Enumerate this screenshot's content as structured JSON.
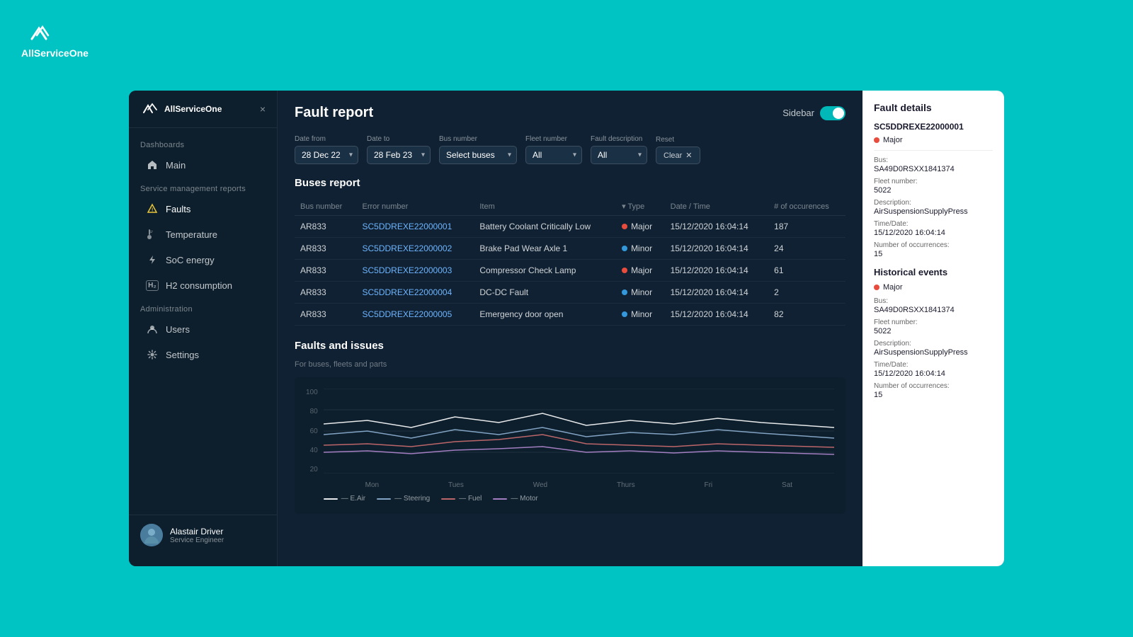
{
  "app": {
    "name": "AllServiceOne",
    "bg_color": "#00c4c4"
  },
  "sidebar": {
    "logo_text": "AllServiceOne",
    "close_icon": "×",
    "sections": [
      {
        "label": "Dashboards",
        "items": [
          {
            "id": "main",
            "label": "Main",
            "icon": "🏠",
            "active": false
          }
        ]
      },
      {
        "label": "Service management reports",
        "items": [
          {
            "id": "faults",
            "label": "Faults",
            "icon": "⚠",
            "active": true
          },
          {
            "id": "temperature",
            "label": "Temperature",
            "icon": "📊",
            "active": false
          },
          {
            "id": "soc-energy",
            "label": "SoC energy",
            "icon": "⚡",
            "active": false
          },
          {
            "id": "h2-consumption",
            "label": "H2 consumption",
            "icon": "H₂",
            "active": false
          }
        ]
      },
      {
        "label": "Administration",
        "items": [
          {
            "id": "users",
            "label": "Users",
            "icon": "👤",
            "active": false
          },
          {
            "id": "settings",
            "label": "Settings",
            "icon": "⚙",
            "active": false
          }
        ]
      }
    ],
    "user": {
      "name": "Alastair Driver",
      "role": "Service Engineer"
    }
  },
  "page": {
    "title": "Fault report",
    "sidebar_toggle_label": "Sidebar"
  },
  "filters": {
    "date_from_label": "Date from",
    "date_from_value": "28 Dec 22",
    "date_to_label": "Date to",
    "date_to_value": "28 Feb 23",
    "bus_number_label": "Bus number",
    "bus_number_value": "Select buses",
    "fleet_number_label": "Fleet number",
    "fleet_number_value": "All",
    "fault_description_label": "Fault description",
    "fault_description_value": "All",
    "reset_label": "Reset",
    "clear_label": "Clear"
  },
  "buses_report": {
    "title": "Buses report",
    "columns": [
      "Bus number",
      "Error number",
      "Item",
      "Type",
      "Date / Time",
      "# of occurences"
    ],
    "rows": [
      {
        "bus": "AR833",
        "error": "SC5DDREXE22000001",
        "item": "Battery Coolant Critically Low",
        "type": "Major",
        "datetime": "15/12/2020 16:04:14",
        "occurrences": "187"
      },
      {
        "bus": "AR833",
        "error": "SC5DDREXE22000002",
        "item": "Brake Pad Wear Axle 1",
        "type": "Minor",
        "datetime": "15/12/2020 16:04:14",
        "occurrences": "24"
      },
      {
        "bus": "AR833",
        "error": "SC5DDREXE22000003",
        "item": "Compressor Check Lamp",
        "type": "Major",
        "datetime": "15/12/2020 16:04:14",
        "occurrences": "61"
      },
      {
        "bus": "AR833",
        "error": "SC5DDREXE22000004",
        "item": "DC-DC Fault",
        "type": "Minor",
        "datetime": "15/12/2020 16:04:14",
        "occurrences": "2"
      },
      {
        "bus": "AR833",
        "error": "SC5DDREXE22000005",
        "item": "Emergency door open",
        "type": "Minor",
        "datetime": "15/12/2020 16:04:14",
        "occurrences": "82"
      }
    ]
  },
  "chart": {
    "title": "Faults and issues",
    "subtitle": "For buses, fleets and parts",
    "y_labels": [
      "100",
      "80",
      "60",
      "40",
      "20"
    ],
    "x_labels": [
      "Mon",
      "Tues",
      "Wed",
      "Thurs",
      "Fri",
      "Sat"
    ],
    "legend": [
      {
        "label": "E.Air",
        "color": "#ffffff"
      },
      {
        "label": "Steering",
        "color": "#a0c4e8"
      },
      {
        "label": "Fuel",
        "color": "#e8a0a0"
      },
      {
        "label": "Motor",
        "color": "#d0a0e8"
      }
    ]
  },
  "fault_details": {
    "panel_title": "Fault details",
    "fault_id": "SC5DDREXE22000001",
    "severity": "Major",
    "bus_label": "Bus:",
    "bus_value": "SA49D0RSXX1841374",
    "fleet_label": "Fleet number:",
    "fleet_value": "5022",
    "description_label": "Description:",
    "description_value": "AirSuspensionSupplyPress",
    "time_label": "Time/Date:",
    "time_value": "15/12/2020 16:04:14",
    "occurrences_label": "Number of occurrences:",
    "occurrences_value": "15",
    "historical_title": "Historical events",
    "historical_severity": "Major",
    "historical_bus_label": "Bus:",
    "historical_bus_value": "SA49D0RSXX1841374",
    "historical_fleet_label": "Fleet number:",
    "historical_fleet_value": "5022",
    "historical_description_label": "Description:",
    "historical_description_value": "AirSuspensionSupplyPress",
    "historical_time_label": "Time/Date:",
    "historical_time_value": "15/12/2020 16:04:14",
    "historical_occurrences_label": "Number of occurrences:",
    "historical_occurrences_value": "15"
  }
}
